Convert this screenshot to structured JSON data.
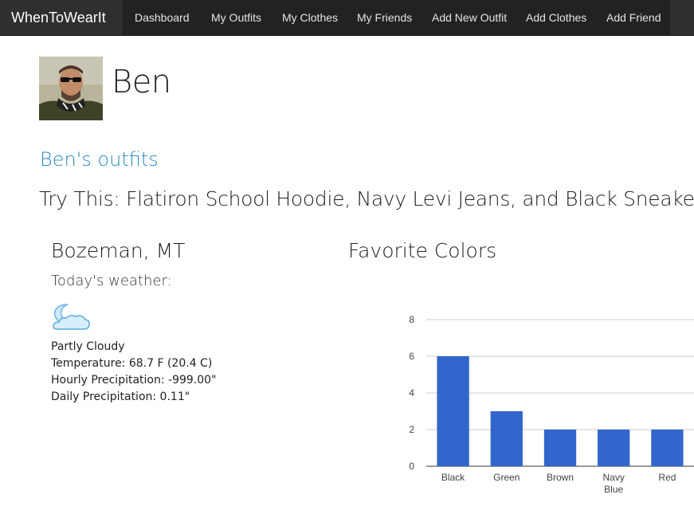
{
  "nav": {
    "brand": "WhenToWearIt",
    "items": [
      "Dashboard",
      "My Outfits",
      "My Clothes",
      "My Friends",
      "Add New Outfit",
      "Add Clothes",
      "Add Friend"
    ]
  },
  "profile": {
    "name": "Ben",
    "avatar_icon": "profile-photo"
  },
  "outfits": {
    "heading": "Ben's outfits",
    "suggestion": "Try This: Flatiron School Hoodie, Navy Levi Jeans, and Black Sneakers"
  },
  "weather": {
    "city": "Bozeman, MT",
    "label": "Today's weather:",
    "icon": "partly-cloudy-night-icon",
    "condition": "Partly Cloudy",
    "temperature": "Temperature: 68.7 F (20.4 C)",
    "hourly_precip": "Hourly Precipitation: -999.00\"",
    "daily_precip": "Daily Precipitation: 0.11\""
  },
  "chart_title": "Favorite Colors",
  "chart_data": {
    "type": "bar",
    "categories": [
      "Black",
      "Green",
      "Brown",
      "Navy Blue",
      "Red"
    ],
    "values": [
      6,
      3,
      2,
      2,
      2
    ],
    "ylim": [
      0,
      8
    ],
    "yticks": [
      0,
      2,
      4,
      6,
      8
    ],
    "bar_color": "#3366cc",
    "grid": true
  }
}
